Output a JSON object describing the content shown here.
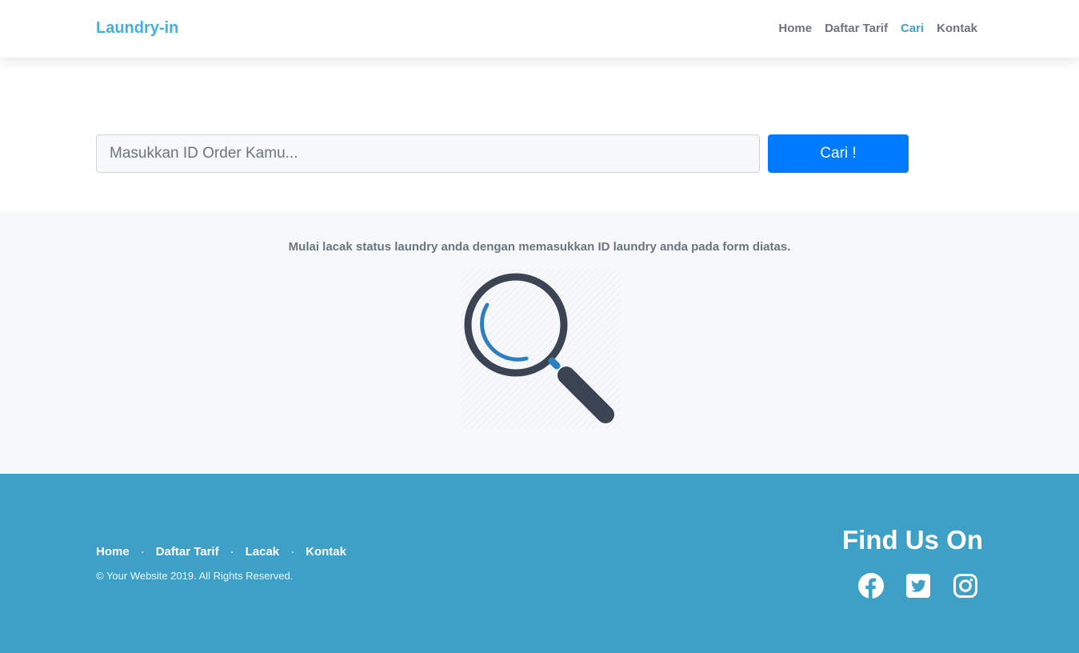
{
  "navbar": {
    "brand": "Laundry-in",
    "links": [
      {
        "label": "Home"
      },
      {
        "label": "Daftar Tarif"
      },
      {
        "label": "Cari"
      },
      {
        "label": "Kontak"
      }
    ]
  },
  "search": {
    "placeholder": "Masukkan ID Order Kamu...",
    "value": "",
    "button_label": "Cari !"
  },
  "info": {
    "text": "Mulai lacak status laundry anda dengan memasukkan ID laundry anda pada form diatas.",
    "illustration_icon": "magnifier-icon"
  },
  "footer": {
    "links": [
      {
        "label": "Home"
      },
      {
        "label": "Daftar Tarif"
      },
      {
        "label": "Lacak"
      },
      {
        "label": "Kontak"
      }
    ],
    "separator": "·",
    "copyright": "© Your Website 2019. All Rights Reserved.",
    "find_us_title": "Find Us On",
    "social_icons": [
      "facebook-icon",
      "twitter-icon",
      "instagram-icon"
    ]
  },
  "colors": {
    "brand": "#3eb1e0",
    "active_nav": "#3fa0cd",
    "primary_button": "#007bff",
    "footer_bg": "#3fa0c7",
    "magnifier_dark": "#3b4452",
    "magnifier_accent": "#2d7fc1"
  }
}
